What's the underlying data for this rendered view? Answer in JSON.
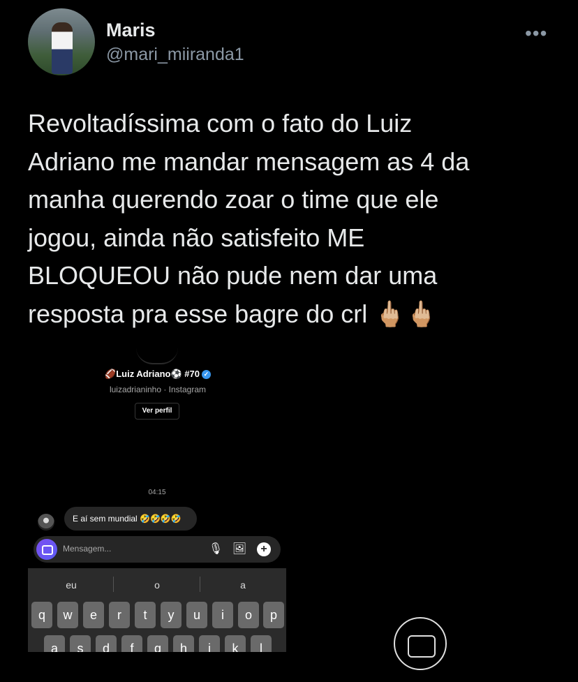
{
  "tweet": {
    "author_name": "Maris",
    "author_handle": "@mari_miiranda1",
    "more_icon": "•••",
    "text": "Revoltadíssima com o fato do Luiz\nAdriano me mandar mensagem as 4 da\nmanha querendo zoar o time que ele\njogou, ainda não satisfeito ME\nBLOQUEOU não pude nem dar uma\nresposta pra esse bagre do crl 🖕🏼🖕🏼"
  },
  "instagram": {
    "profile_name": "🏈Luiz Adriano⚽️ #70",
    "verified_icon": "✓",
    "profile_sub": "luizadrianinho · Instagram",
    "view_profile": "Ver perfil",
    "time": "04:15",
    "message": "E aí sem mundial 🤣🤣🤣🤣",
    "input_placeholder": "Mensagem...",
    "mic_icon": "🎙",
    "image_icon": "🖼",
    "plus_icon": "+"
  },
  "keyboard": {
    "suggestions": [
      "eu",
      "o",
      "a"
    ],
    "row1": [
      "q",
      "w",
      "e",
      "r",
      "t",
      "y",
      "u",
      "i",
      "o",
      "p"
    ],
    "row2": [
      "a",
      "s",
      "d",
      "f",
      "g",
      "h",
      "j",
      "k",
      "l"
    ]
  }
}
